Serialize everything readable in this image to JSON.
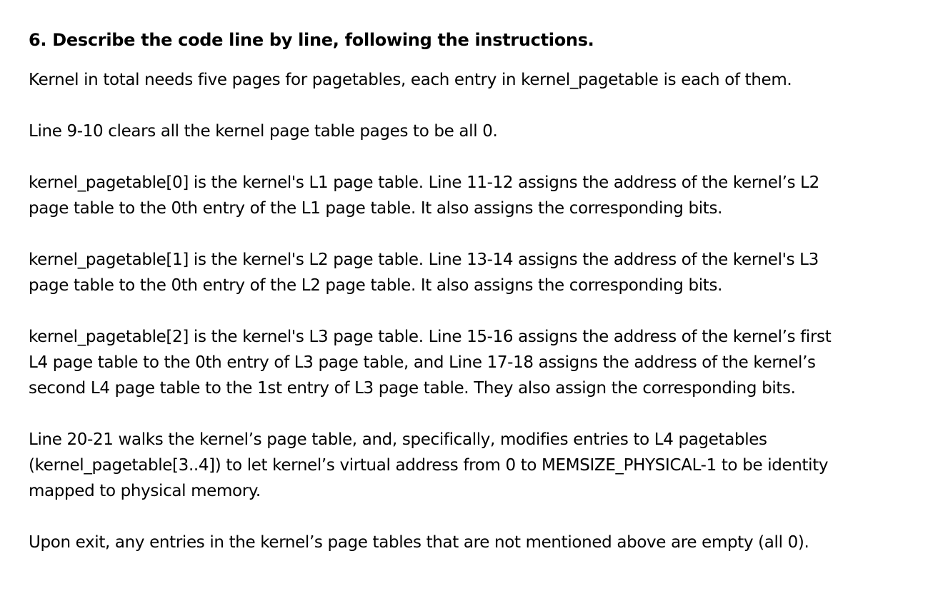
{
  "document": {
    "heading": "6. Describe the code line by line, following the instructions.",
    "paragraphs": [
      {
        "lines": [
          "Kernel in total needs five pages for pagetables, each entry in kernel_pagetable is each of them."
        ]
      },
      {
        "lines": [
          "Line 9-10 clears all the kernel page table pages to be all 0."
        ]
      },
      {
        "lines": [
          "kernel_pagetable[0] is the kernel's L1 page table. Line 11-12 assigns the address of the kernel’s L2",
          "page table to the 0th entry of the L1 page table. It also assigns the corresponding bits."
        ]
      },
      {
        "lines": [
          "kernel_pagetable[1] is the kernel's L2 page table. Line 13-14 assigns the address of the kernel's L3",
          "page table to the 0th entry of the L2 page table. It also assigns the corresponding bits."
        ]
      },
      {
        "lines": [
          "kernel_pagetable[2] is the kernel's L3 page table. Line 15-16 assigns the address of the kernel’s first",
          "L4 page table to the 0th entry of L3 page table, and Line 17-18 assigns the address of the kernel’s",
          "second L4 page table to the 1st entry of L3 page table. They also assign the corresponding bits."
        ]
      },
      {
        "lines": [
          "Line 20-21 walks the kernel’s page table, and, specifically, modifies entries to L4 pagetables",
          "(kernel_pagetable[3..4]) to let kernel’s virtual address from 0 to MEMSIZE_PHYSICAL-1 to be identity",
          "mapped to physical memory."
        ]
      },
      {
        "lines": [
          "Upon exit, any entries in the kernel’s page tables that are not mentioned above are empty (all 0)."
        ]
      }
    ]
  }
}
